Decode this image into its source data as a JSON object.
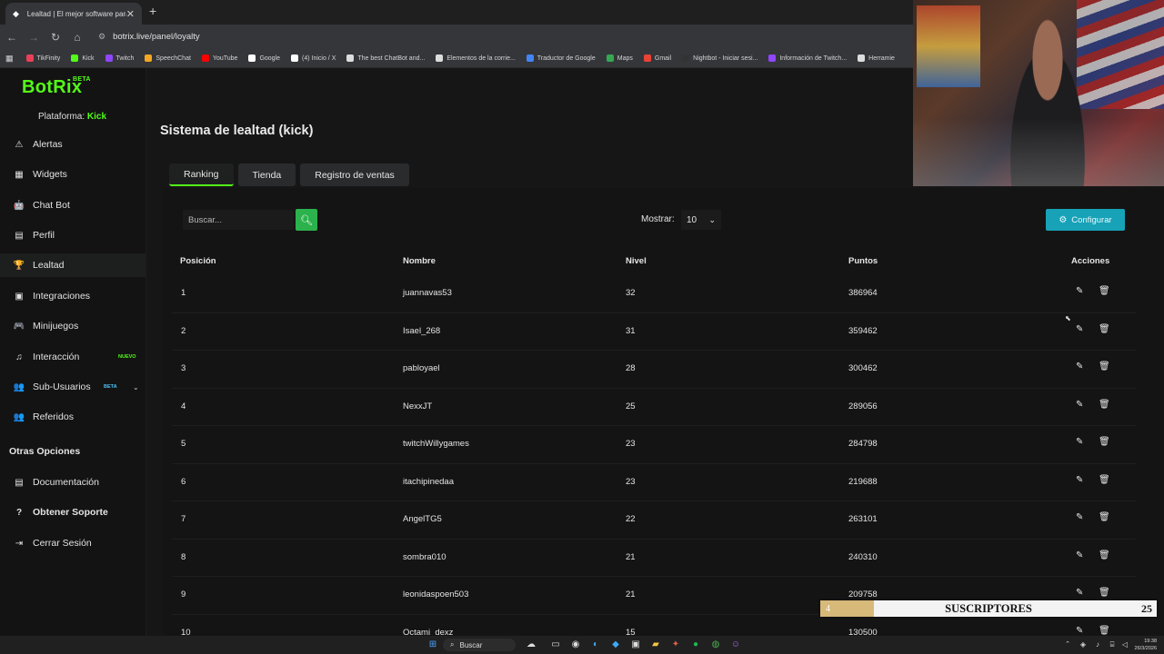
{
  "browser": {
    "tab_title": "Lealtad | El mejor software para pe",
    "tab_close": "✕",
    "new_tab": "+",
    "url": "botrix.live/panel/loyalty",
    "bookmarks": [
      {
        "label": "TikFinity",
        "color": "#e94057"
      },
      {
        "label": "Kick",
        "color": "#53fc18"
      },
      {
        "label": "Twitch",
        "color": "#9146ff"
      },
      {
        "label": "SpeechChat",
        "color": "#f5a623"
      },
      {
        "label": "YouTube",
        "color": "#ff0000"
      },
      {
        "label": "Google",
        "color": "#ffffff"
      },
      {
        "label": "(4) Inicio / X",
        "color": "#ffffff"
      },
      {
        "label": "The best ChatBot and...",
        "color": "#dddddd"
      },
      {
        "label": "Elementos de la corrie...",
        "color": "#dddddd"
      },
      {
        "label": "Traductor de Google",
        "color": "#4285f4"
      },
      {
        "label": "Maps",
        "color": "#34a853"
      },
      {
        "label": "Gmail",
        "color": "#ea4335"
      },
      {
        "label": "Nightbot - Iniciar sesi...",
        "color": "#333333"
      },
      {
        "label": "Información de Twitch...",
        "color": "#9146ff"
      },
      {
        "label": "Herramie",
        "color": "#dddddd"
      }
    ]
  },
  "sidebar": {
    "logo": "BotRix",
    "logo_badge": "BETA",
    "platform_label": "Plataforma:",
    "platform_value": "Kick",
    "items": [
      {
        "label": "Alertas",
        "icon": "⚠"
      },
      {
        "label": "Widgets",
        "icon": "▦"
      },
      {
        "label": "Chat Bot",
        "icon": "🤖"
      },
      {
        "label": "Perfil",
        "icon": "▤"
      },
      {
        "label": "Lealtad",
        "icon": "🏆"
      },
      {
        "label": "Integraciones",
        "icon": "▣"
      },
      {
        "label": "Minijuegos",
        "icon": "🎮"
      },
      {
        "label": "Interacción",
        "icon": "♫",
        "badge": "NUEVO"
      },
      {
        "label": "Sub-Usuarios",
        "icon": "👥",
        "badge": "BETA"
      },
      {
        "label": "Referidos",
        "icon": "👥"
      }
    ],
    "section_title": "Otras Opciones",
    "other_items": [
      {
        "label": "Documentación",
        "icon": "▤"
      },
      {
        "label": "Obtener Soporte",
        "icon": "?"
      },
      {
        "label": "Cerrar Sesión",
        "icon": "⇥"
      }
    ]
  },
  "main": {
    "title": "Sistema de lealtad (kick)",
    "tabs": [
      "Ranking",
      "Tienda",
      "Registro de ventas"
    ],
    "search_placeholder": "Buscar...",
    "show_label": "Mostrar:",
    "show_value": "10",
    "config_label": "Configurar",
    "columns": [
      "Posición",
      "Nombre",
      "Nivel",
      "Puntos",
      "Acciones"
    ],
    "rows": [
      {
        "pos": "1",
        "name": "juannavas53",
        "level": "32",
        "points": "386964"
      },
      {
        "pos": "2",
        "name": "Isael_268",
        "level": "31",
        "points": "359462"
      },
      {
        "pos": "3",
        "name": "pabloyael",
        "level": "28",
        "points": "300462"
      },
      {
        "pos": "4",
        "name": "NexxJT",
        "level": "25",
        "points": "289056"
      },
      {
        "pos": "5",
        "name": "twitchWillygames",
        "level": "23",
        "points": "284798"
      },
      {
        "pos": "6",
        "name": "itachipinedaa",
        "level": "23",
        "points": "219688"
      },
      {
        "pos": "7",
        "name": "AngelTG5",
        "level": "22",
        "points": "263101"
      },
      {
        "pos": "8",
        "name": "sombra010",
        "level": "21",
        "points": "240310"
      },
      {
        "pos": "9",
        "name": "leonidaspoen503",
        "level": "21",
        "points": "209758"
      },
      {
        "pos": "10",
        "name": "Octami_dexz",
        "level": "15",
        "points": "130500"
      }
    ]
  },
  "overlay": {
    "label": "SUSCRIPTORES",
    "current": "4",
    "goal": "25",
    "progress": 0.16
  },
  "taskbar": {
    "search_label": "Buscar",
    "time": "19:38",
    "date": "26/3/2026"
  }
}
